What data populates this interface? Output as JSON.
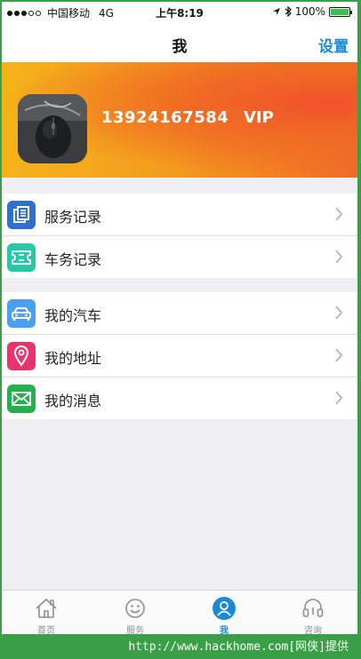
{
  "status_bar": {
    "carrier": "中国移动",
    "network": "4G",
    "time": "上午8:19",
    "battery_percent": "100%",
    "battery_color": "#33c24a",
    "signal_bars_filled": 3,
    "signal_bars_total": 5
  },
  "navbar": {
    "title": "我",
    "settings_label": "设置",
    "accent_color": "#1a8ad9"
  },
  "profile": {
    "phone": "13924167584",
    "level": "VIP",
    "avatar_icon": "mouse-photo"
  },
  "menu_group_1": [
    {
      "label": "服务记录",
      "icon": "document-list-icon",
      "color": "#2f6fcf"
    },
    {
      "label": "车务记录",
      "icon": "ticket-icon",
      "color": "#25c9a7"
    }
  ],
  "menu_group_2": [
    {
      "label": "我的汽车",
      "icon": "car-icon",
      "color": "#4a9ff0"
    },
    {
      "label": "我的地址",
      "icon": "location-pin-icon",
      "color": "#e8336f"
    },
    {
      "label": "我的消息",
      "icon": "mail-icon",
      "color": "#21b34a"
    }
  ],
  "tabbar": [
    {
      "label": "首页",
      "icon": "home-icon",
      "active": false
    },
    {
      "label": "服务",
      "icon": "smiley-icon",
      "active": false
    },
    {
      "label": "我",
      "icon": "user-icon",
      "active": true
    },
    {
      "label": "咨询",
      "icon": "headset-icon",
      "active": false
    }
  ],
  "watermark": "http://www.hackhome.com[网侠]提供"
}
